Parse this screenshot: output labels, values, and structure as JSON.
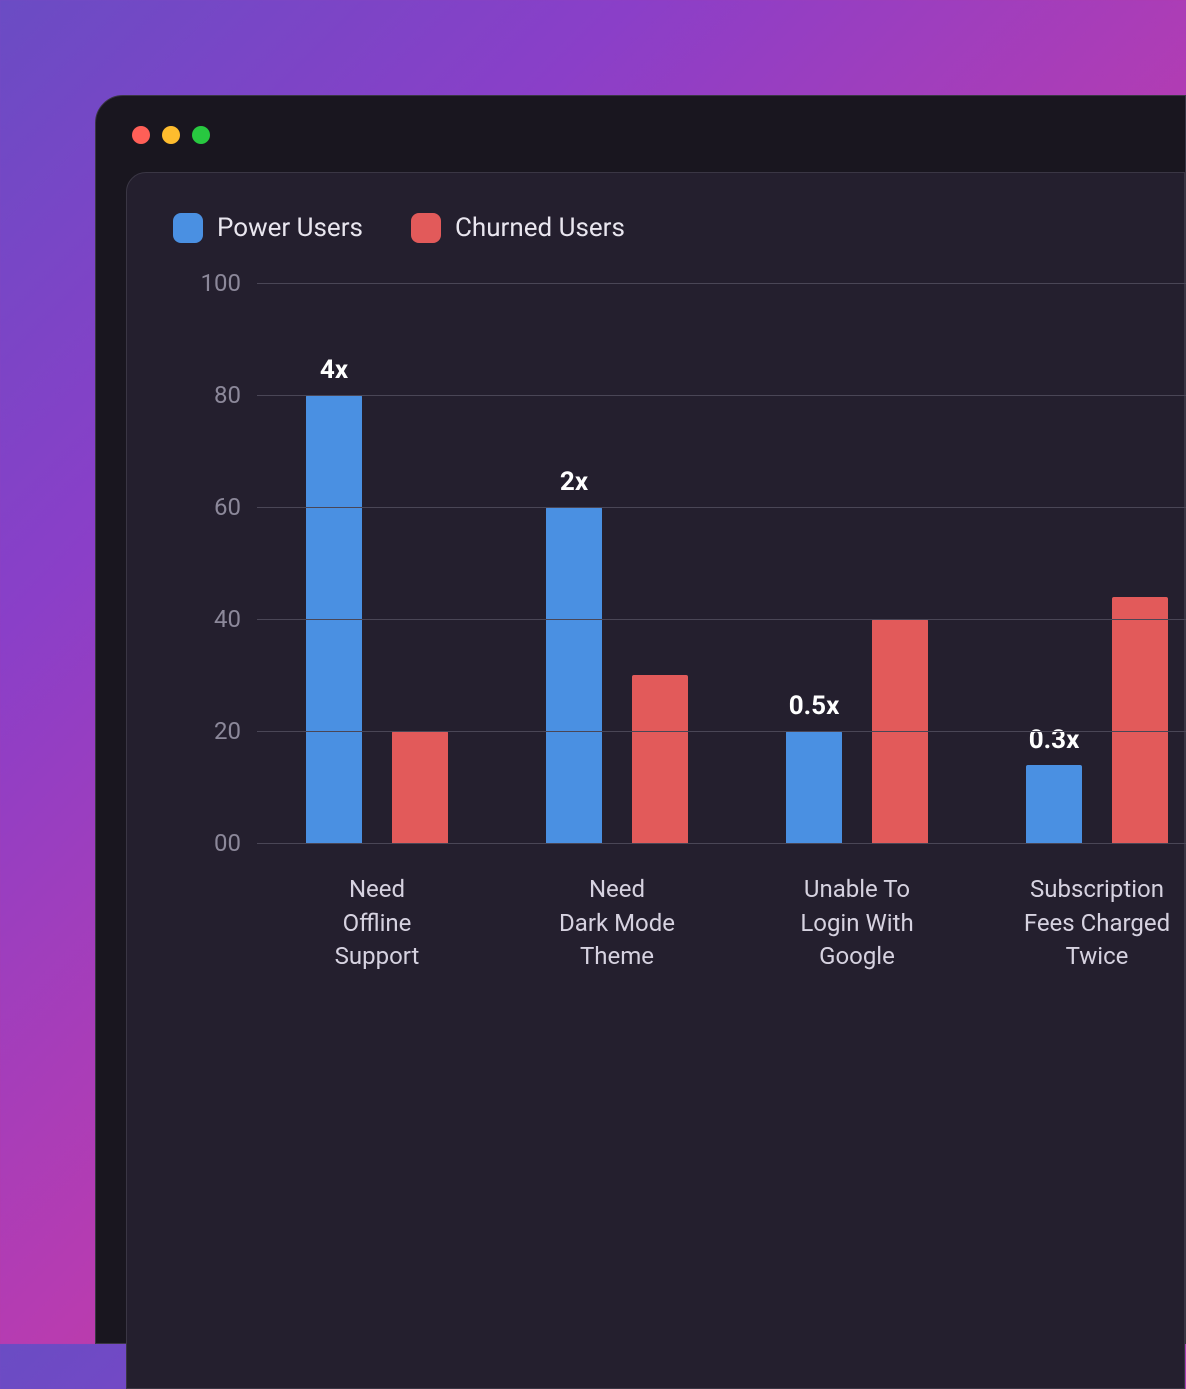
{
  "legend": {
    "series_a": "Power Users",
    "series_b": "Churned Users"
  },
  "y_ticks": [
    "100",
    "80",
    "60",
    "40",
    "20",
    "00"
  ],
  "chart_data": {
    "type": "bar",
    "ylim": [
      0,
      100
    ],
    "categories": [
      "Need\nOffline\nSupport",
      "Need\nDark Mode\nTheme",
      "Unable To\nLogin With\nGoogle",
      "Subscription\nFees Charged\nTwice"
    ],
    "series": [
      {
        "name": "Power Users",
        "color": "#4a90e2",
        "values": [
          80,
          60,
          20,
          14
        ]
      },
      {
        "name": "Churned Users",
        "color": "#e25a5a",
        "values": [
          20,
          30,
          40,
          44
        ]
      }
    ],
    "ratio_labels": [
      "4x",
      "2x",
      "0.5x",
      "0.3x"
    ]
  }
}
